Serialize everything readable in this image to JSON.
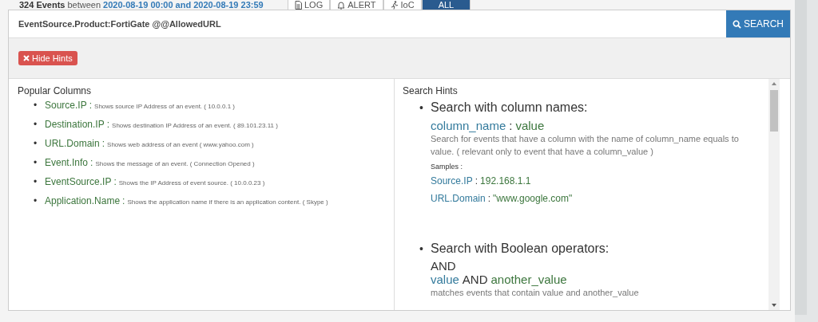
{
  "summary": {
    "count": "324 Events",
    "between": "between",
    "range": "2020-08-19 00:00 and 2020-08-19 23:59"
  },
  "view_tabs": [
    {
      "label": "LOG",
      "selected": false
    },
    {
      "label": "ALERT",
      "selected": false
    },
    {
      "label": "IoC",
      "selected": false
    },
    {
      "label": "ALL",
      "selected": true
    }
  ],
  "search": {
    "value": "EventSource.Product:FortiGate @@AllowedURL",
    "button": "SEARCH"
  },
  "hide_hints_button": "Hide Hints",
  "popular_columns": {
    "title": "Popular Columns",
    "items": [
      {
        "bullet": "•",
        "name": "Source.IP",
        "separator": ":",
        "description": "Shows source IP Address of an event. ( 10.0.0.1 )"
      },
      {
        "bullet": "•",
        "name": "Destination.IP",
        "separator": ":",
        "description": "Shows destination IP Address of an event. ( 89.101.23.11 )"
      },
      {
        "bullet": "•",
        "name": "URL.Domain",
        "separator": ":",
        "description": "Shows web address of an event ( www.yahoo.com )"
      },
      {
        "bullet": "•",
        "name": "Event.Info",
        "separator": ":",
        "description": "Shows the message of an event. ( Connection Opened )"
      },
      {
        "bullet": "•",
        "name": "EventSource.IP",
        "separator": ":",
        "description": "Shows the IP Address of event source. ( 10.0.0.23 )"
      },
      {
        "bullet": "•",
        "name": "Application.Name",
        "separator": ":",
        "description": "Shows the application name if there is an application content. ( Skype )"
      }
    ]
  },
  "search_hints": {
    "title": "Search Hints",
    "items": [
      {
        "bullet": "•",
        "title": "Search with column names:",
        "blocks": [
          {
            "kind": "syntax",
            "key": "column_name",
            "separator": ":",
            "value": "value"
          },
          {
            "kind": "description",
            "text": "Search for events that have a column with the name of column_name equals to value. ( relevant only to event that have a column_value )"
          },
          {
            "kind": "label",
            "text": "Samples :"
          },
          {
            "kind": "sample",
            "key": "Source.IP",
            "separator": ":",
            "value": "192.168.1.1"
          },
          {
            "kind": "sample",
            "key": "URL.Domain",
            "separator": ":",
            "value": "\"www.google.com\""
          }
        ]
      },
      {
        "bullet": "•",
        "title": "Search with Boolean operators:",
        "blocks": [
          {
            "kind": "operator",
            "text": "AND"
          },
          {
            "kind": "syntax",
            "key": "value",
            "separator": "AND",
            "value": "another_value"
          },
          {
            "kind": "description",
            "text": "matches events that contain value and another_value"
          }
        ]
      }
    ]
  }
}
